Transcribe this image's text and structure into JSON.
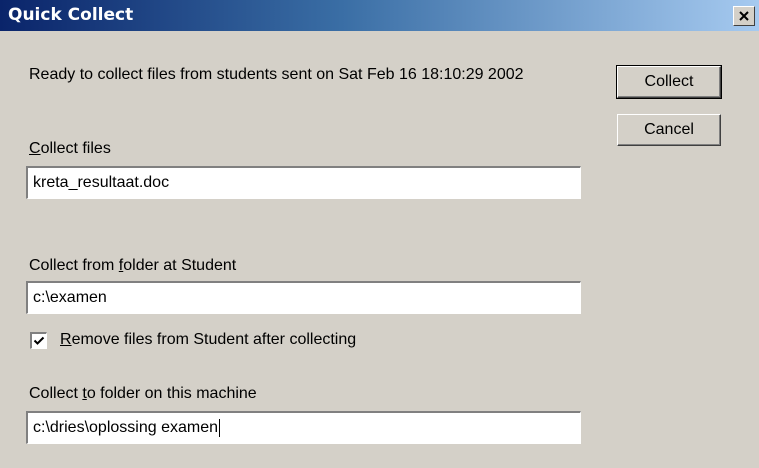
{
  "window": {
    "title": "Quick Collect",
    "close_icon": "close-icon"
  },
  "message": "Ready to collect files from students sent on Sat Feb 16 18:10:29 2002",
  "buttons": {
    "collect": "Collect",
    "cancel": "Cancel"
  },
  "collect_files": {
    "label_accel": "C",
    "label_rest": "ollect files",
    "value": "kreta_resultaat.doc"
  },
  "student_folder": {
    "label_pre": "Collect from ",
    "label_accel": "f",
    "label_post": "older at Student",
    "value": "c:\\examen"
  },
  "remove_files": {
    "checked": true,
    "label_accel": "R",
    "label_rest": "emove files from Student after collecting"
  },
  "local_folder": {
    "label_pre": "Collect ",
    "label_accel": "t",
    "label_post": "o folder on this machine",
    "value": "c:\\dries\\oplossing examen"
  },
  "colors": {
    "dialog_bg": "#d4d0c8",
    "title_start": "#0a246a",
    "title_end": "#a6caf0"
  }
}
